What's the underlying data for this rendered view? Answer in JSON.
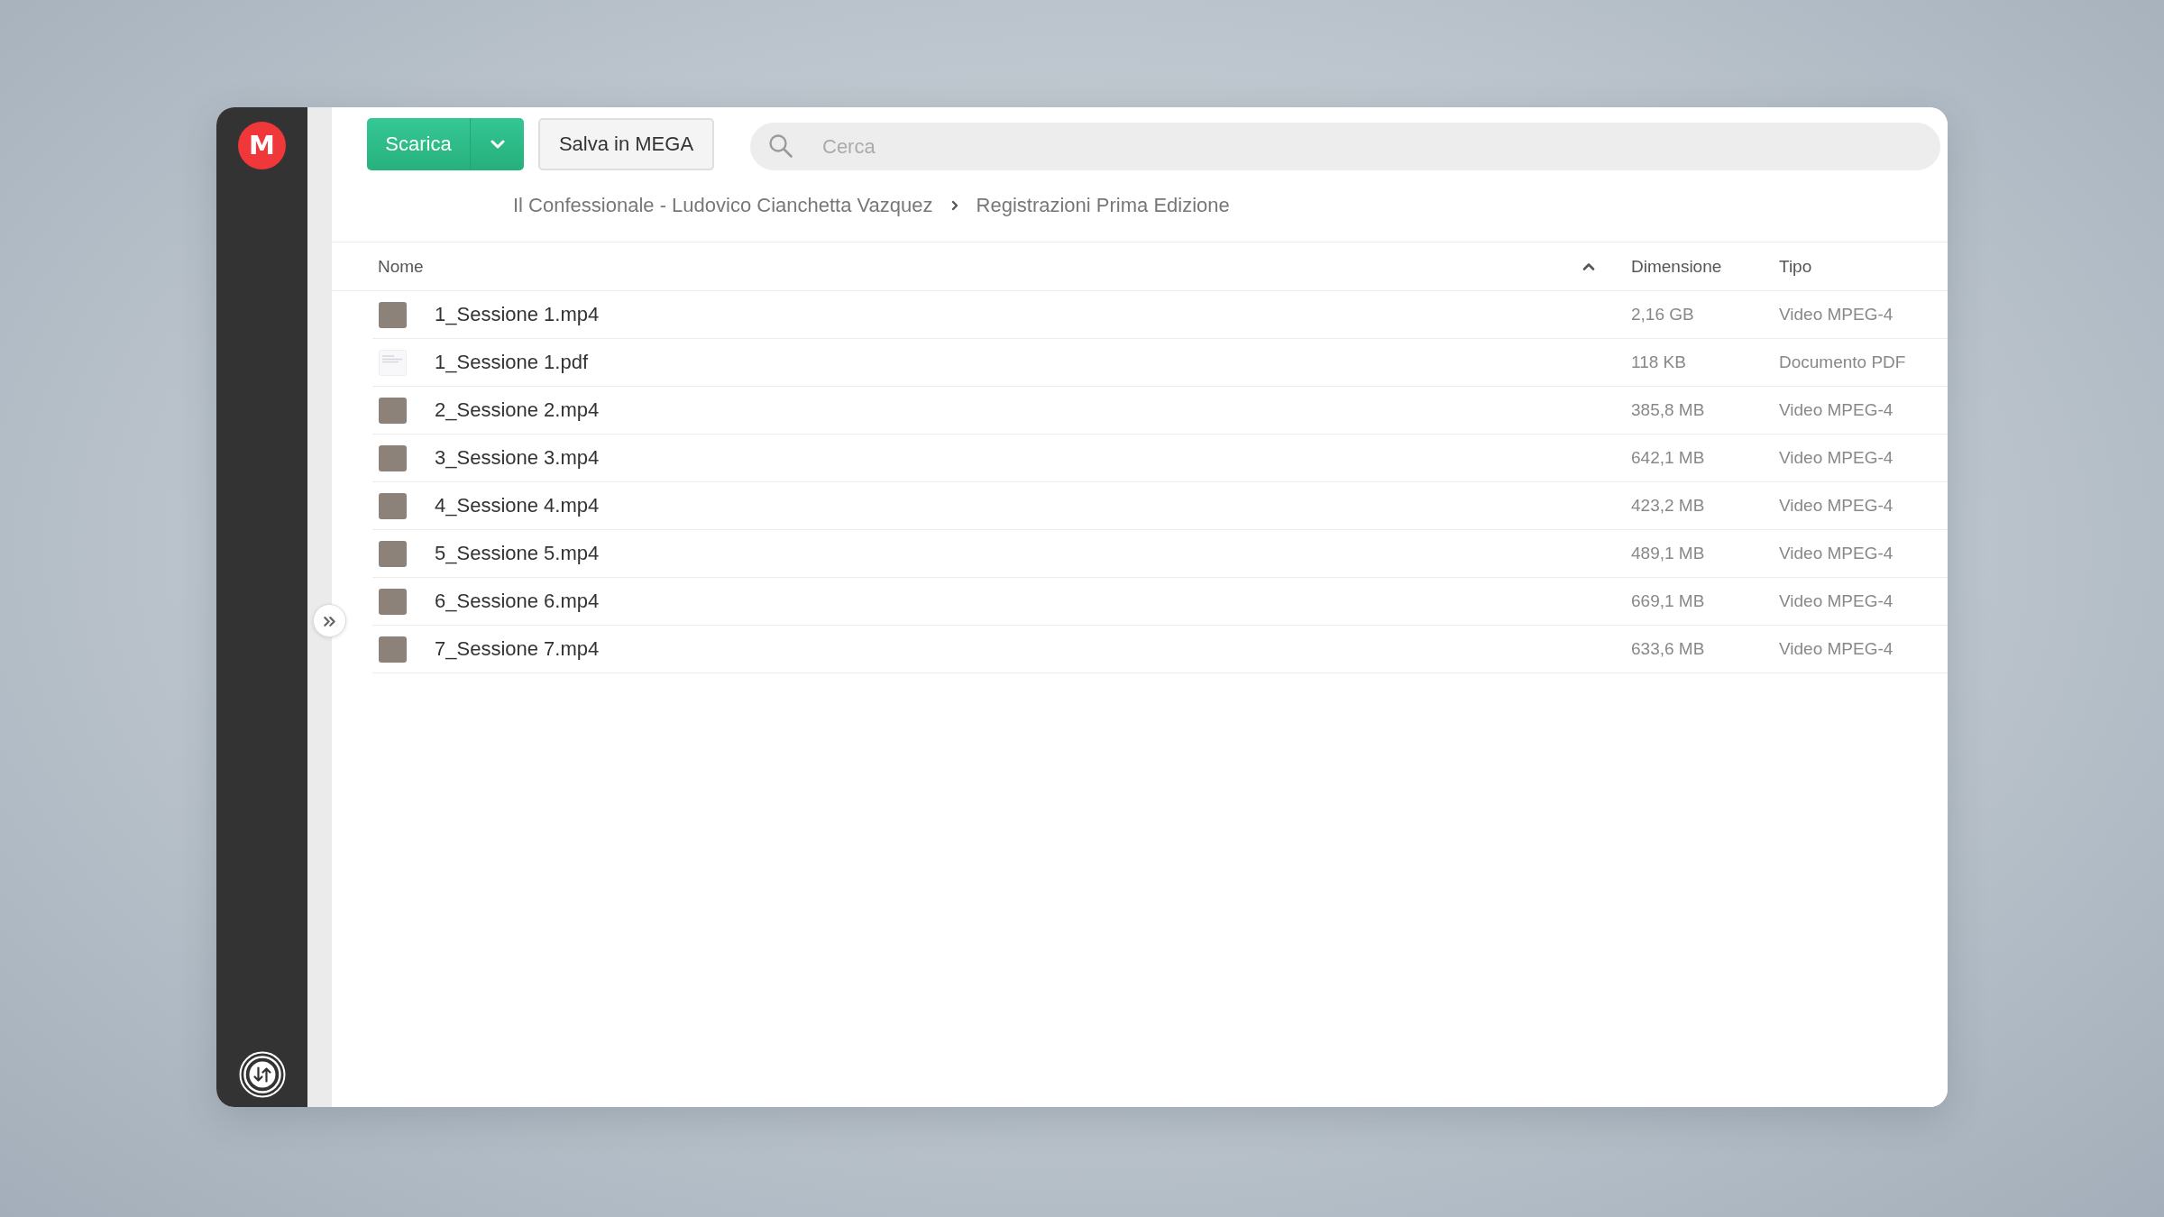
{
  "sidebar": {
    "logo": "M"
  },
  "toolbar": {
    "download_button": "Scarica",
    "save_button": "Salva in MEGA",
    "search": {
      "placeholder": "Cerca"
    }
  },
  "breadcrumb": [
    {
      "label": "Il Confessionale - Ludovico Cianchetta Vazquez"
    },
    {
      "label": "Registrazioni Prima Edizione"
    }
  ],
  "table": {
    "columns": [
      {
        "label": "Nome",
        "sorted": true
      },
      {
        "label": "Dimensione",
        "sorted": false
      },
      {
        "label": "Tipo",
        "sorted": false
      }
    ],
    "rows": [
      {
        "kind": "video",
        "name": "1_Sessione 1.mp4",
        "size": "2,16 GB",
        "type": "Video MPEG-4"
      },
      {
        "kind": "document",
        "name": "1_Sessione 1.pdf",
        "size": "118 KB",
        "type": "Documento PDF"
      },
      {
        "kind": "video",
        "name": "2_Sessione 2.mp4",
        "size": "385,8 MB",
        "type": "Video MPEG-4"
      },
      {
        "kind": "video",
        "name": "3_Sessione 3.mp4",
        "size": "642,1 MB",
        "type": "Video MPEG-4"
      },
      {
        "kind": "video",
        "name": "4_Sessione 4.mp4",
        "size": "423,2 MB",
        "type": "Video MPEG-4"
      },
      {
        "kind": "video",
        "name": "5_Sessione 5.mp4",
        "size": "489,1 MB",
        "type": "Video MPEG-4"
      },
      {
        "kind": "video",
        "name": "6_Sessione 6.mp4",
        "size": "669,1 MB",
        "type": "Video MPEG-4"
      },
      {
        "kind": "video",
        "name": "7_Sessione 7.mp4",
        "size": "633,6 MB",
        "type": "Video MPEG-4"
      }
    ]
  }
}
